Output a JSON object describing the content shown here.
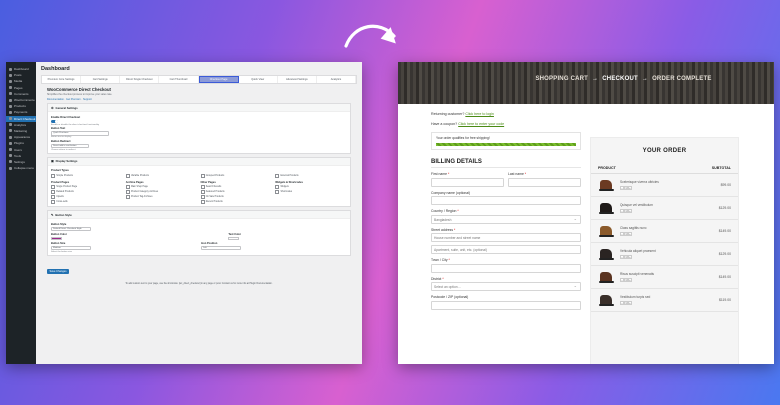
{
  "admin": {
    "page_title": "Dashboard",
    "sidebar": [
      "Dashboard",
      "Posts",
      "Media",
      "Pages",
      "Comments",
      "WooCommerce",
      "Products",
      "Payments",
      "Direct Checkout",
      "Analytics",
      "Marketing",
      "Appearance",
      "Plugins",
      "Users",
      "Tools",
      "Settings",
      "Collapse menu"
    ],
    "active_sidebar_index": 8,
    "tabs": [
      "Premium Core Settings",
      "Cart Settings",
      "Direct Single Checkout",
      "Cart Thumbnail",
      "Checkout Page",
      "Quick View",
      "Advanced Settings",
      "Analytics"
    ],
    "active_tab_index": 4,
    "plugin_title": "WooCommerce Direct Checkout",
    "plugin_desc": "Simplifies the checkout process to improve your sales rate.",
    "links": "Documentation · Get Premium · Support",
    "general": {
      "title": "General Settings",
      "enable_label": "Enable Direct Checkout",
      "enable_hint": "Enable or disable the direct checkout functionality",
      "button_text_label": "Button Text",
      "button_text_value": "Quick Purchase",
      "button_text_hint": "Button text to display",
      "redirect_label": "Button Redirect",
      "redirect_value": "Direct add to cart button",
      "redirect_hint": "Choose where to redirect"
    },
    "display": {
      "title": "Display Settings",
      "product_types_label": "Product Types",
      "product_types": [
        "Simple Products",
        "Variable Products",
        "Grouped Products",
        "External Products"
      ],
      "product_pages_label": "Product Pages",
      "product_pages": [
        "Single Product Page",
        "Related Products",
        "Upsells",
        "Cross-sells"
      ],
      "archive_pages_label": "Archive Pages",
      "archive_pages": [
        "Main Shop Page",
        "Product Category Archives",
        "Product Tag Archives"
      ],
      "other_pages_label": "Other Pages",
      "other_pages": [
        "Search Results",
        "Featured Products",
        "On Sale Products",
        "Recent Products"
      ],
      "widgets_label": "Widgets & Shortcodes",
      "widgets": [
        "Widgets",
        "Shortcodes"
      ]
    },
    "button_style": {
      "title": "Button Style",
      "style_label": "Button Style",
      "style_value": "Default Direct Checkout Style",
      "color_label": "Button Color",
      "text_color_label": "Text Color",
      "size_label": "Button Size",
      "size_value": "Medium",
      "size_hint": "Select the button size",
      "position_label": "Icon Position",
      "position_value": "Left",
      "swatch_color": "#9b2a8a"
    },
    "save_label": "Save Changes",
    "footer": "To add custom text to your page, use the shortcode: [wc_direct_checkout] in any page or post. Contact us for more info at Plugin Documentation."
  },
  "checkout": {
    "steps": [
      "SHOPPING CART",
      "CHECKOUT",
      "ORDER COMPLETE"
    ],
    "arrow": "→",
    "returning": "Returning customer?",
    "returning_link": "Click here to login",
    "coupon": "Have a coupon?",
    "coupon_link": "Click here to enter your code",
    "shipping_notice": "Your order qualifies for free shipping!",
    "billing_title": "BILLING DETAILS",
    "fields": {
      "first_name": "First name",
      "last_name": "Last name",
      "company": "Company name (optional)",
      "country": "Country / Region",
      "country_value": "Bangladesh",
      "street": "Street address",
      "street_placeholder": "House number and street name",
      "apartment_placeholder": "Apartment, suite, unit, etc. (optional)",
      "town": "Town / City",
      "district": "District",
      "district_placeholder": "Select an option…",
      "postcode": "Postcode / ZIP (optional)"
    },
    "order": {
      "title": "YOUR ORDER",
      "col_product": "PRODUCT",
      "col_subtotal": "SUBTOTAL",
      "items": [
        {
          "name": "Scelerisque viverra ultricies",
          "price": "$99.00",
          "color": "#6b3a22"
        },
        {
          "name": "Quisque vel vestibulum",
          "price": "$129.00",
          "color": "#1f1a18"
        },
        {
          "name": "Class sagittis nunc",
          "price": "$149.00",
          "color": "#8b5a2b"
        },
        {
          "name": "Vehicula aliquet praesent",
          "price": "$129.00",
          "color": "#2a2422"
        },
        {
          "name": "Risus suscipit venenatis",
          "price": "$149.00",
          "color": "#5a3320"
        },
        {
          "name": "Vestibulum turpis sed",
          "price": "$119.00",
          "color": "#3a2f2a"
        }
      ]
    }
  },
  "colors": {
    "accent_admin": "#2271b1",
    "link_green": "#4a8b14"
  }
}
